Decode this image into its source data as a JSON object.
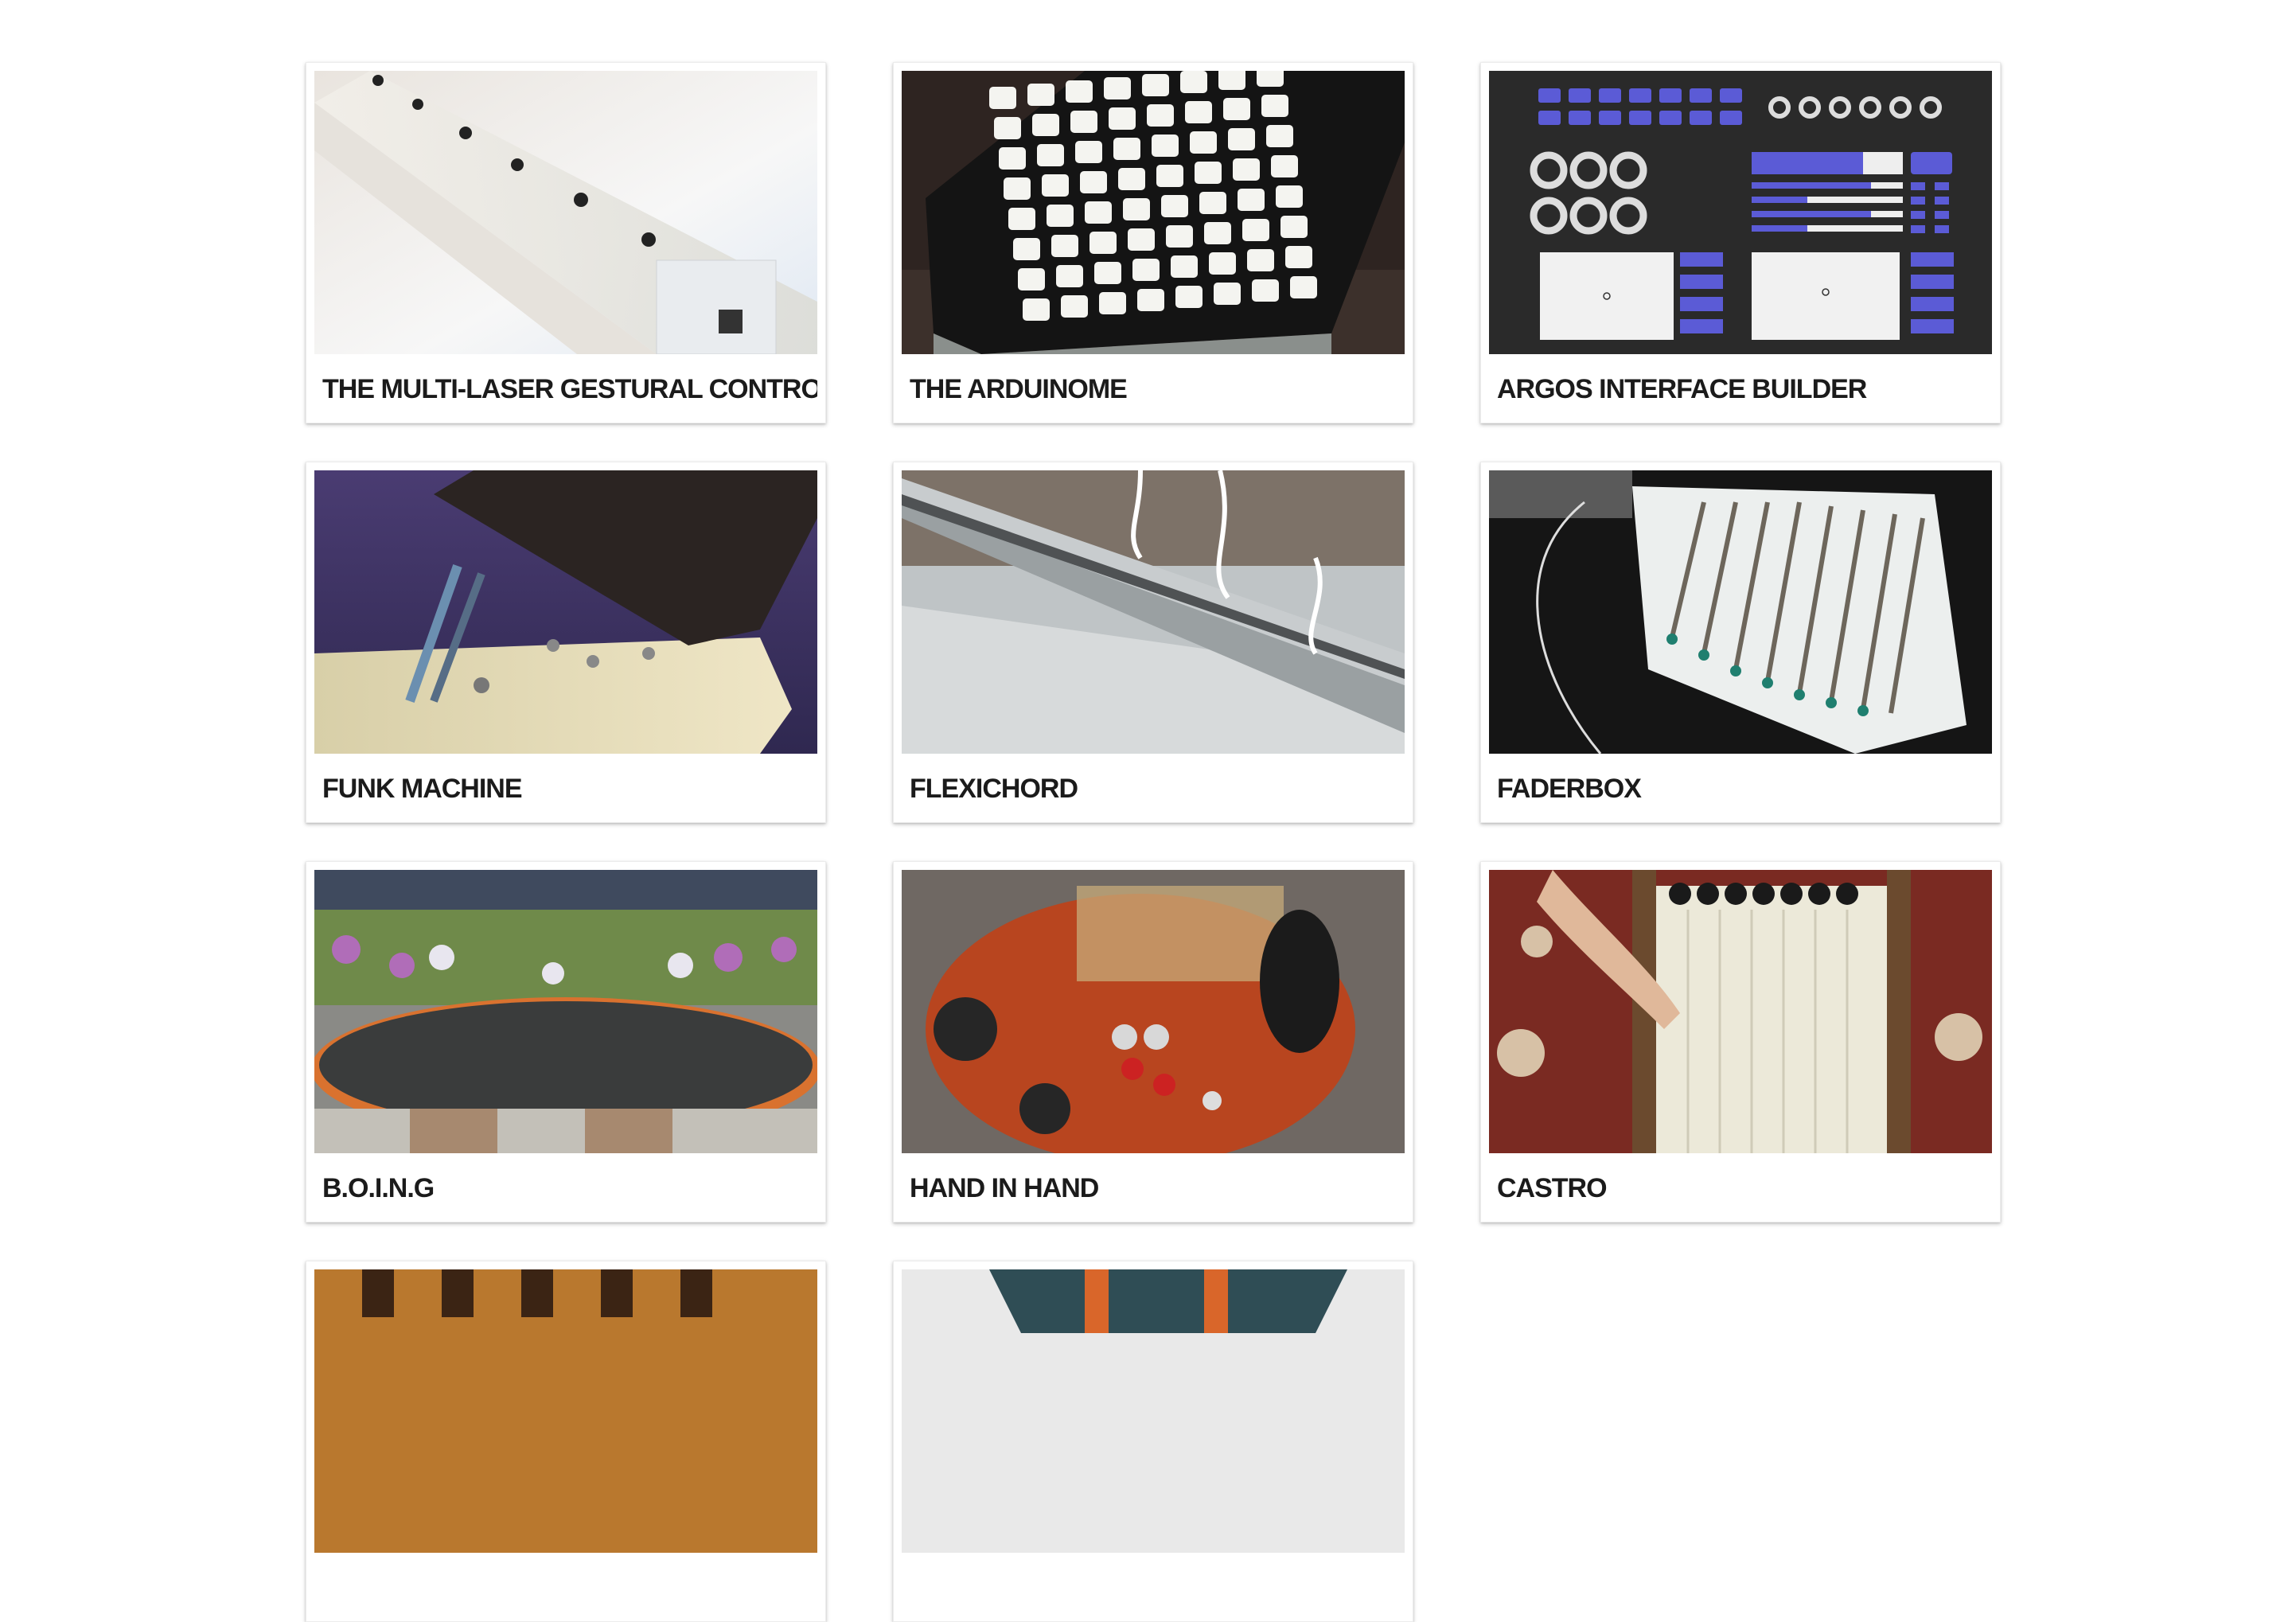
{
  "projects": [
    {
      "title": "THE MULTI-LASER GESTURAL CONTROLLER",
      "image": "multi-laser-controller-photo"
    },
    {
      "title": "THE ARDUINOME",
      "image": "arduinome-button-grid-photo"
    },
    {
      "title": "ARGOS INTERFACE BUILDER",
      "image": "argos-interface-screenshot"
    },
    {
      "title": "FUNK MACHINE",
      "image": "funk-machine-photo"
    },
    {
      "title": "FLEXICHORD",
      "image": "flexichord-photo"
    },
    {
      "title": "FADERBOX",
      "image": "faderbox-photo"
    },
    {
      "title": "B.O.I.N.G",
      "image": "boing-trampoline-photo"
    },
    {
      "title": "HAND IN HAND",
      "image": "hand-in-hand-photo"
    },
    {
      "title": "CASTRO",
      "image": "castro-photo"
    },
    {
      "title": "",
      "image": "project-photo"
    },
    {
      "title": "",
      "image": "project-photo"
    }
  ],
  "colors": {
    "background": "#ffffff",
    "title_text": "#1b1b1b",
    "argos_accent": "#5b5bd6",
    "argos_bg": "#2a2a2a"
  }
}
